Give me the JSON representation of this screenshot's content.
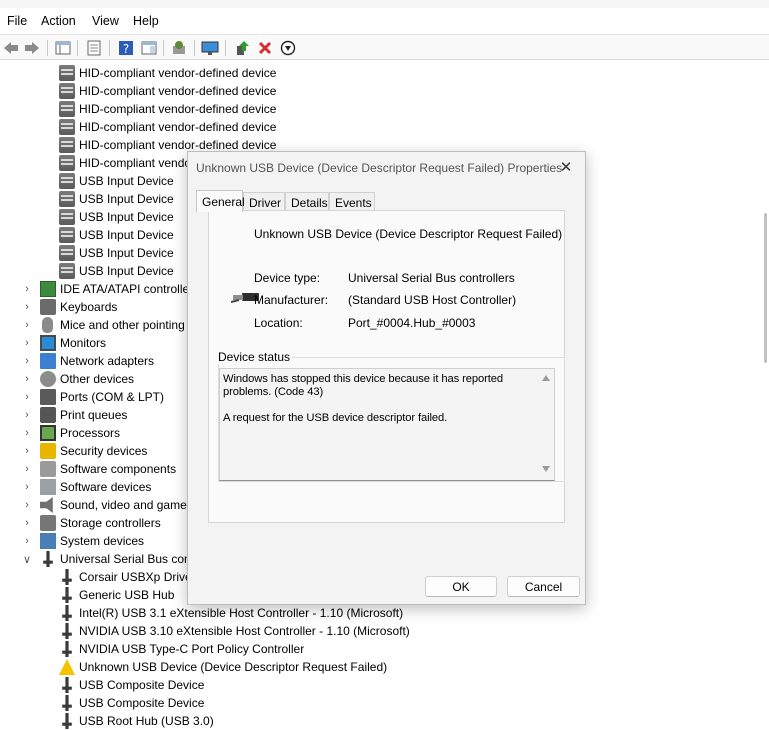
{
  "menu": [
    "File",
    "Action",
    "View",
    "Help"
  ],
  "toolbar": {
    "icons": [
      "back-icon",
      "forward-icon",
      "show-hide-tree-icon",
      "properties-icon",
      "help-icon",
      "action-pane-icon",
      "scan-hardware-icon",
      "monitor-icon",
      "update-driver-icon",
      "uninstall-icon",
      "disable-icon"
    ]
  },
  "tree": {
    "hid_children": [
      "HID-compliant vendor-defined device",
      "HID-compliant vendor-defined device",
      "HID-compliant vendor-defined device",
      "HID-compliant vendor-defined device",
      "HID-compliant vendor-defined device",
      "HID-compliant vendor-defined device",
      "USB Input Device",
      "USB Input Device",
      "USB Input Device",
      "USB Input Device",
      "USB Input Device",
      "USB Input Device"
    ],
    "categories": [
      "IDE ATA/ATAPI controllers",
      "Keyboards",
      "Mice and other pointing devices",
      "Monitors",
      "Network adapters",
      "Other devices",
      "Ports (COM & LPT)",
      "Print queues",
      "Processors",
      "Security devices",
      "Software components",
      "Software devices",
      "Sound, video and game controllers",
      "Storage controllers",
      "System devices",
      "Universal Serial Bus controllers"
    ],
    "usb_children": [
      "Corsair USBXp Driver",
      "Generic USB Hub",
      "Intel(R) USB 3.1 eXtensible Host Controller - 1.10 (Microsoft)",
      "NVIDIA USB 3.10 eXtensible Host Controller - 1.10 (Microsoft)",
      "NVIDIA USB Type-C Port Policy Controller",
      "Unknown USB Device (Device Descriptor Request Failed)",
      "USB Composite Device",
      "USB Composite Device",
      "USB Root Hub (USB 3.0)"
    ]
  },
  "dialog": {
    "title": "Unknown USB Device (Device Descriptor Request Failed) Properties",
    "close_glyph": "✕",
    "tabs": [
      "General",
      "Driver",
      "Details",
      "Events"
    ],
    "active_tab": "General",
    "device_name": "Unknown USB Device (Device Descriptor Request Failed)",
    "properties": {
      "device_type_label": "Device type:",
      "device_type_value": "Universal Serial Bus controllers",
      "manufacturer_label": "Manufacturer:",
      "manufacturer_value": "(Standard USB Host Controller)",
      "location_label": "Location:",
      "location_value": "Port_#0004.Hub_#0003"
    },
    "status_label": "Device status",
    "status_line1": "Windows has stopped this device because it has reported problems. (Code 43)",
    "status_line2": "A request for the USB device descriptor failed.",
    "ok_label": "OK",
    "cancel_label": "Cancel"
  },
  "colors": {
    "warning": "#f3c300",
    "uninstall_red": "#d32f2f",
    "accent_blue": "#2a6fd1"
  }
}
